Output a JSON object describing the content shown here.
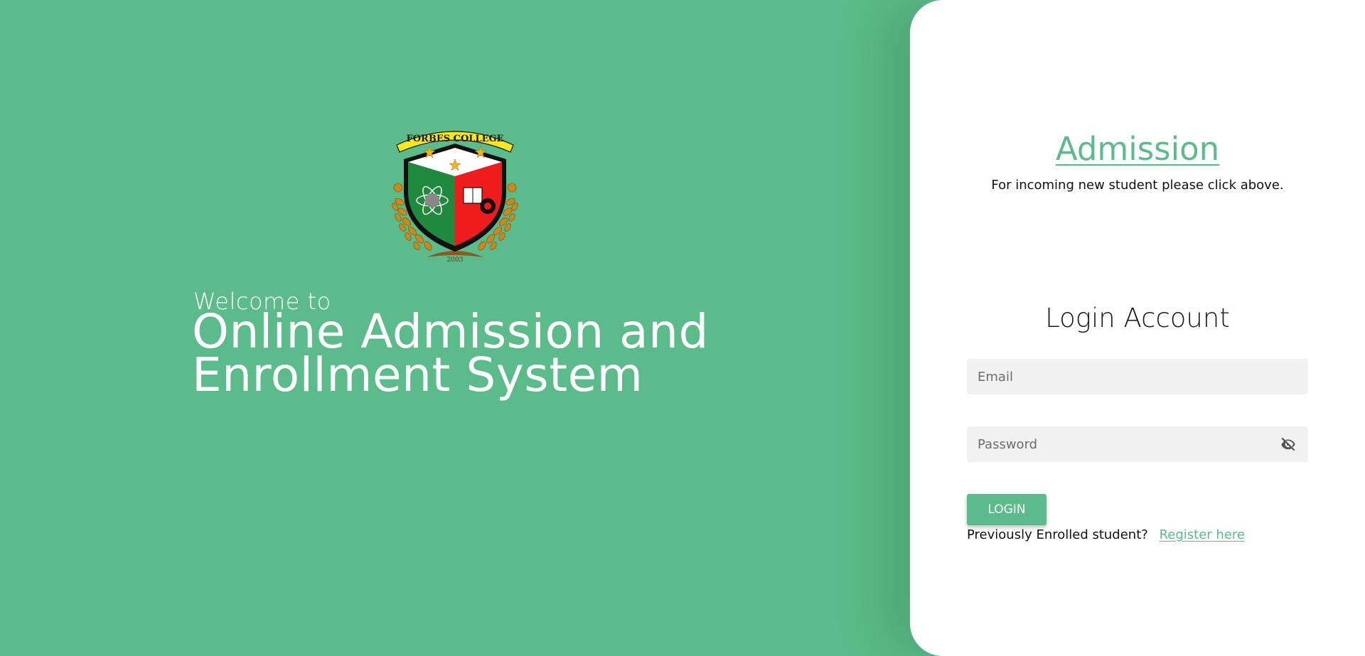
{
  "hero": {
    "logo_text": "FORBES COLLEGE",
    "logo_year": "2003",
    "welcome_small": "Welcome to",
    "title_line1": "Online Admission and",
    "title_line2": "Enrollment System"
  },
  "card": {
    "admission_link": "Admission",
    "admission_note": "For incoming new student please click above.",
    "login_title": "Login Account",
    "email_placeholder": "Email",
    "password_placeholder": "Password",
    "login_button": "LOGIN",
    "register_prompt": "Previously Enrolled student?",
    "register_link": "Register here"
  },
  "icons": {
    "password_toggle": "eye-off-icon"
  },
  "colors": {
    "brand_green": "#5cbb8a",
    "card_bg": "#ffffff",
    "field_bg": "#f1f1f1"
  }
}
